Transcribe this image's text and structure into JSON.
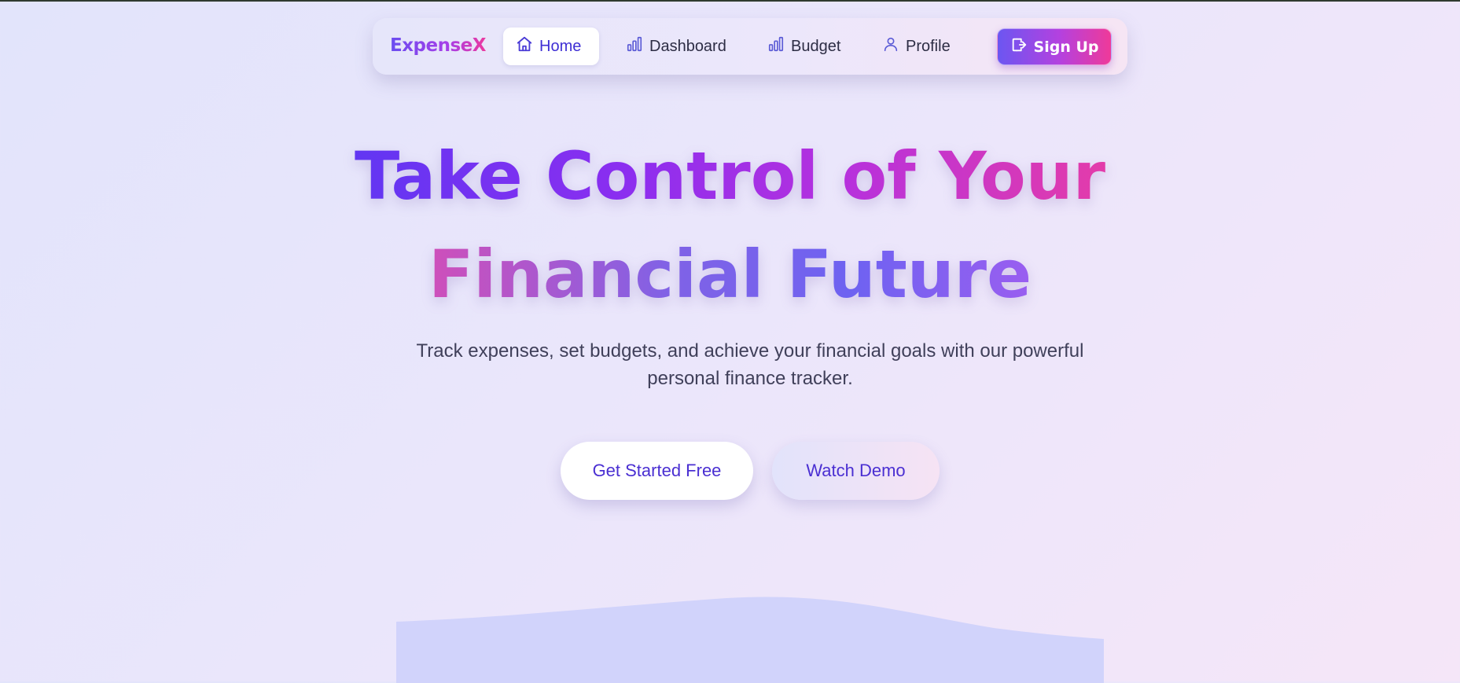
{
  "nav": {
    "logo": "ExpenseX",
    "items": [
      {
        "label": "Home",
        "icon": "home-icon",
        "active": true
      },
      {
        "label": "Dashboard",
        "icon": "bar-chart-icon",
        "active": false
      },
      {
        "label": "Budget",
        "icon": "bar-chart-icon",
        "active": false
      },
      {
        "label": "Profile",
        "icon": "user-icon",
        "active": false
      }
    ],
    "signup": {
      "label": "Sign Up",
      "icon": "login-icon"
    }
  },
  "hero": {
    "title_line1": "Take Control of Your",
    "title_line2": "Financial Future",
    "subtitle": "Track expenses, set budgets, and achieve your financial goals with our powerful personal finance tracker.",
    "primary_button": "Get Started Free",
    "secondary_button": "Watch Demo"
  },
  "colors": {
    "accent_purple": "#6236f2",
    "accent_pink": "#ec3a9f",
    "button_text": "#4a2fd2",
    "wave": "#d1d3fb"
  }
}
